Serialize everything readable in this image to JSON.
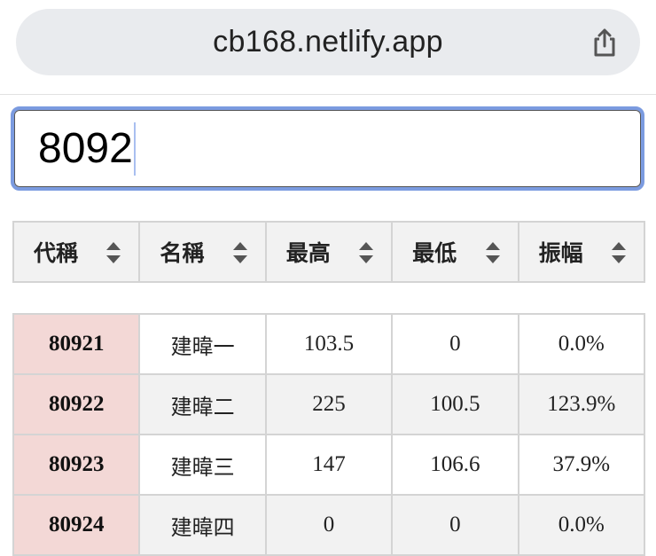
{
  "browser": {
    "url": "cb168.netlify.app",
    "share_icon": "share-icon"
  },
  "search": {
    "value": "8092"
  },
  "table": {
    "headers": [
      "代稱",
      "名稱",
      "最高",
      "最低",
      "振幅"
    ],
    "rows": [
      {
        "code": "80921",
        "name": "建暐一",
        "high": "103.5",
        "low": "0",
        "amplitude": "0.0%"
      },
      {
        "code": "80922",
        "name": "建暐二",
        "high": "225",
        "low": "100.5",
        "amplitude": "123.9%"
      },
      {
        "code": "80923",
        "name": "建暐三",
        "high": "147",
        "low": "106.6",
        "amplitude": "37.9%"
      },
      {
        "code": "80924",
        "name": "建暐四",
        "high": "0",
        "low": "0",
        "amplitude": "0.0%"
      }
    ]
  },
  "colors": {
    "code_cell": "#f3d8d6",
    "focus_ring": "#7b9be0",
    "header_bg": "#f2f2f2"
  }
}
